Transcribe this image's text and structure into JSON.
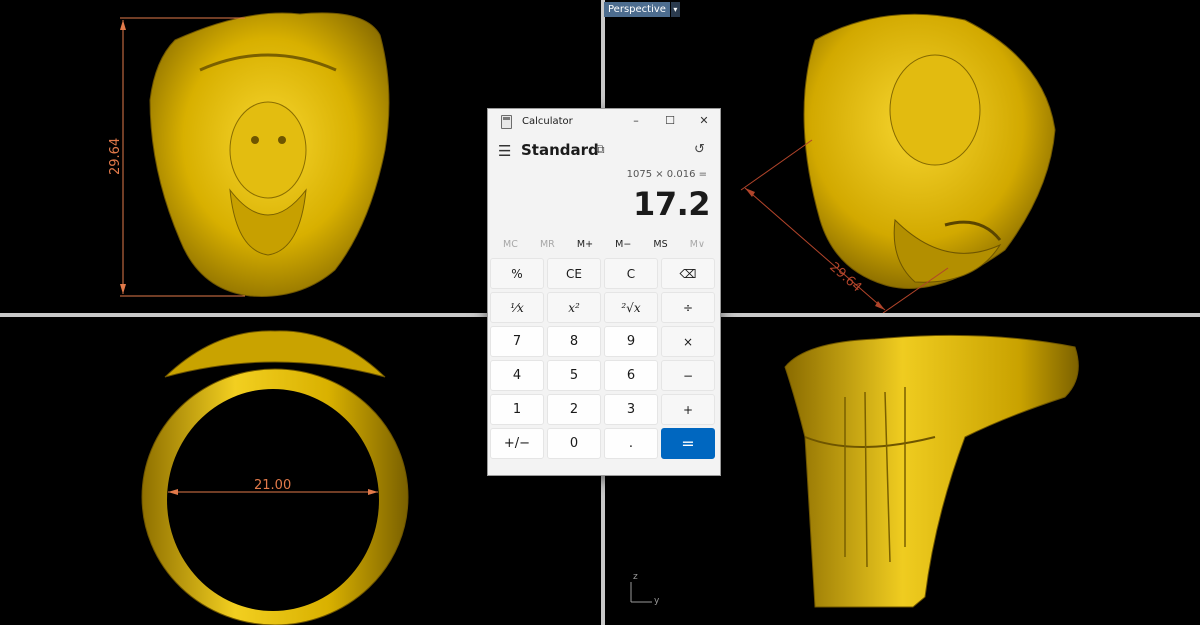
{
  "viewport": {
    "perspective_label": "Perspective",
    "dimensions": {
      "front_height": "29.64",
      "perspective_length": "29.64",
      "inner_diameter": "21.00"
    },
    "axis_labels": {
      "z": "z",
      "y": "y"
    },
    "colors": {
      "ring": "#d9b100",
      "dimension_line": "#e27a4a",
      "background": "#000000"
    }
  },
  "calculator": {
    "title": "Calculator",
    "mode": "Standard",
    "expression": "1075 × 0.016 =",
    "result": "17.2",
    "memory": [
      "MC",
      "MR",
      "M+",
      "M−",
      "MS",
      "M∨"
    ],
    "keys": [
      "%",
      "CE",
      "C",
      "⌫",
      "⅟x",
      "x²",
      "²√x",
      "÷",
      "7",
      "8",
      "9",
      "×",
      "4",
      "5",
      "6",
      "−",
      "1",
      "2",
      "3",
      "+",
      "+/−",
      "0",
      ".",
      "="
    ],
    "accent": "#0067c0"
  }
}
